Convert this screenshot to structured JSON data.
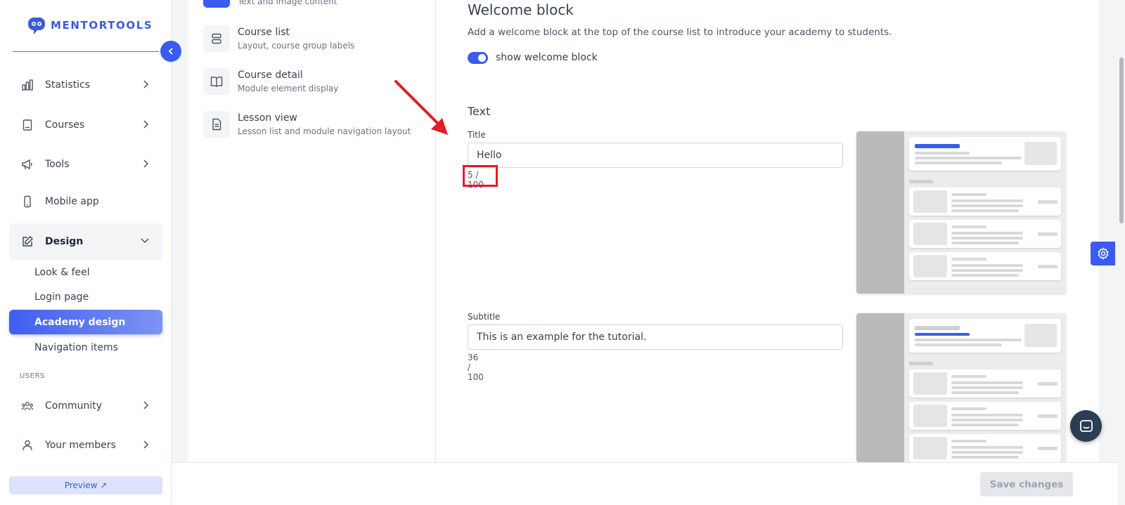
{
  "brand": {
    "name": "MENTORTOOLS",
    "color": "#3b5bdb"
  },
  "sidebar": {
    "items": [
      {
        "label": "Statistics",
        "icon": "bar-chart-icon"
      },
      {
        "label": "Courses",
        "icon": "book-icon"
      },
      {
        "label": "Tools",
        "icon": "megaphone-icon"
      },
      {
        "label": "Mobile app",
        "icon": "phone-icon"
      },
      {
        "label": "Design",
        "icon": "pencil-edit-icon"
      }
    ],
    "design_subitems": [
      "Look & feel",
      "Login page",
      "Academy design",
      "Navigation items"
    ],
    "active_subitem": "Academy design",
    "users_section": "USERS",
    "users_items": [
      {
        "label": "Community",
        "icon": "people-icon"
      },
      {
        "label": "Your members",
        "icon": "user-icon"
      }
    ],
    "preview_label": "Preview ↗"
  },
  "settings_menu": {
    "top_partial_subtitle": "Text and image content",
    "items": [
      {
        "title": "Course list",
        "subtitle": "Layout, course group labels",
        "icon": "list-icon"
      },
      {
        "title": "Course detail",
        "subtitle": "Module element display",
        "icon": "open-book-icon"
      },
      {
        "title": "Lesson view",
        "subtitle": "Lesson list and module navigation layout",
        "icon": "document-icon"
      }
    ]
  },
  "main": {
    "heading": "Welcome block",
    "description": "Add a welcome block at the top of the course list to introduce your academy to students.",
    "toggle_label": "show welcome block",
    "toggle_on": true,
    "text_section": "Text",
    "title_field": {
      "label": "Title",
      "value": "Hello",
      "counter": "5 / 100"
    },
    "subtitle_field": {
      "label": "Subtitle",
      "value": "This is an example for the tutorial.",
      "counter": "36 / 100"
    }
  },
  "footer": {
    "save_label": "Save changes"
  },
  "colors": {
    "accent": "#3b5bf0",
    "highlight": "#e11d2a"
  }
}
